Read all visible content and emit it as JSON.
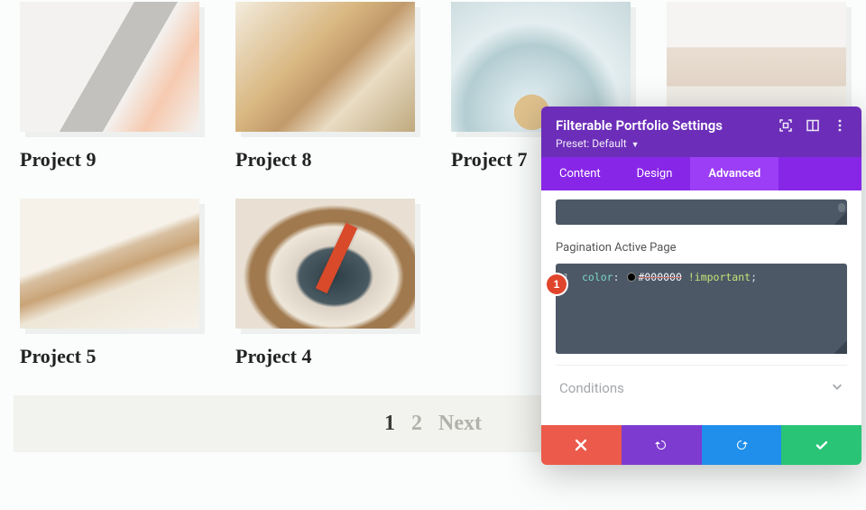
{
  "portfolio": {
    "items": [
      {
        "title": "Project 9"
      },
      {
        "title": "Project 8"
      },
      {
        "title": "Project 7"
      },
      {
        "title": ""
      },
      {
        "title": "Project 5"
      },
      {
        "title": "Project 4"
      }
    ]
  },
  "pagination": {
    "page1": "1",
    "page2": "2",
    "next": "Next"
  },
  "panel": {
    "title": "Filterable Portfolio Settings",
    "preset_label": "Preset:",
    "preset_value": "Default",
    "tabs": {
      "content": "Content",
      "design": "Design",
      "advanced": "Advanced"
    },
    "section_label": "Pagination Active Page",
    "code": {
      "lineno": "1",
      "prop": "color",
      "hex": "#000000",
      "important": "!important"
    },
    "conditions_label": "Conditions",
    "badge": "1"
  }
}
